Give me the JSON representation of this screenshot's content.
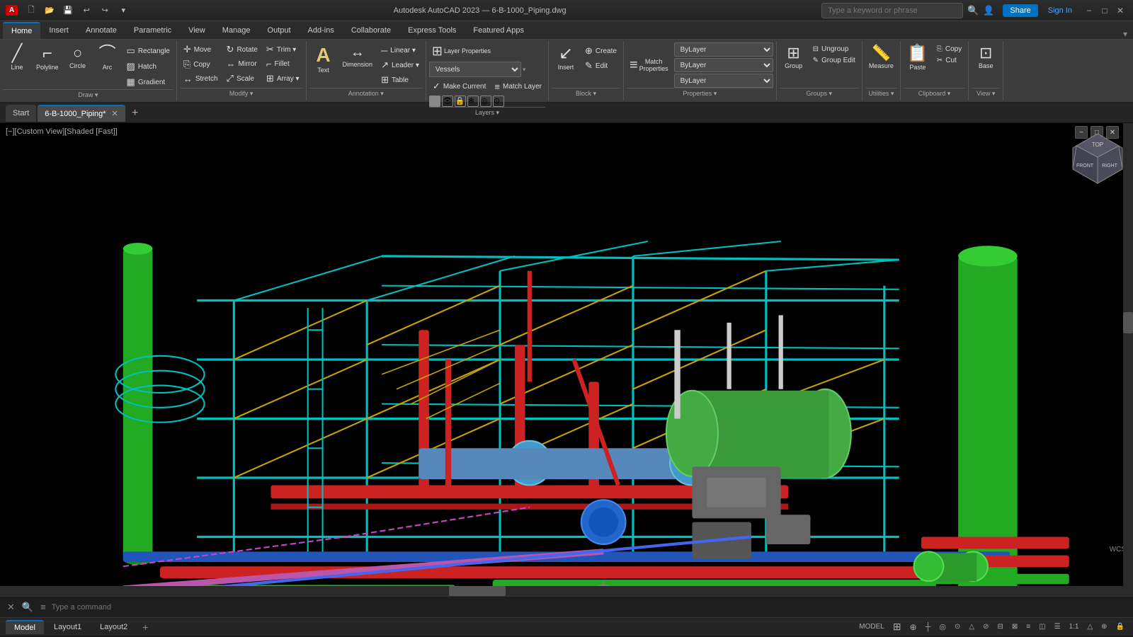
{
  "titlebar": {
    "app_logo": "A",
    "quick_access": [
      "new",
      "open",
      "save",
      "undo",
      "redo"
    ],
    "app_name": "Autodesk AutoCAD 2023",
    "filename": "6-B-1000_Piping.dwg",
    "search_placeholder": "Type a keyword or phrase",
    "share_label": "Share",
    "sign_in_label": "Sign In",
    "win_min": "−",
    "win_max": "□",
    "win_close": "✕"
  },
  "ribbon_tabs": [
    {
      "label": "Home",
      "active": true
    },
    {
      "label": "Insert",
      "active": false
    },
    {
      "label": "Annotate",
      "active": false
    },
    {
      "label": "Parametric",
      "active": false
    },
    {
      "label": "View",
      "active": false
    },
    {
      "label": "Manage",
      "active": false
    },
    {
      "label": "Output",
      "active": false
    },
    {
      "label": "Add-ins",
      "active": false
    },
    {
      "label": "Collaborate",
      "active": false
    },
    {
      "label": "Express Tools",
      "active": false
    },
    {
      "label": "Featured Apps",
      "active": false
    }
  ],
  "ribbon": {
    "sections": {
      "draw": {
        "label": "Draw",
        "buttons": [
          {
            "id": "line",
            "label": "Line",
            "icon": "╱"
          },
          {
            "id": "polyline",
            "label": "Polyline",
            "icon": "⌐"
          },
          {
            "id": "circle",
            "label": "Circle",
            "icon": "○"
          },
          {
            "id": "arc",
            "label": "Arc",
            "icon": "⌒"
          }
        ]
      },
      "modify": {
        "label": "Modify",
        "buttons": [
          {
            "id": "move",
            "label": "Move",
            "icon": "✛"
          },
          {
            "id": "rotate",
            "label": "Rotate",
            "icon": "↻"
          },
          {
            "id": "trim",
            "label": "Trim",
            "icon": "✂"
          },
          {
            "id": "copy",
            "label": "Copy",
            "icon": "⎘"
          },
          {
            "id": "mirror",
            "label": "Mirror",
            "icon": "⇔"
          },
          {
            "id": "fillet",
            "label": "Fillet",
            "icon": "⌐"
          },
          {
            "id": "stretch",
            "label": "Stretch",
            "icon": "↔"
          },
          {
            "id": "scale",
            "label": "Scale",
            "icon": "⤢"
          },
          {
            "id": "array",
            "label": "Array",
            "icon": "⊞"
          }
        ]
      },
      "annotation": {
        "label": "Annotation",
        "buttons": [
          {
            "id": "text",
            "label": "Text",
            "icon": "A"
          },
          {
            "id": "dimension",
            "label": "Dimension",
            "icon": "↔"
          },
          {
            "id": "linear",
            "label": "Linear",
            "icon": "─"
          },
          {
            "id": "leader",
            "label": "Leader",
            "icon": "↗"
          },
          {
            "id": "table",
            "label": "Table",
            "icon": "⊞"
          }
        ]
      },
      "layers": {
        "label": "Layers",
        "layer_name": "Vessels",
        "buttons": [
          {
            "id": "layer-props",
            "label": "Layer Properties",
            "icon": "⊞"
          },
          {
            "id": "make-current",
            "label": "Make Current",
            "icon": "✓"
          },
          {
            "id": "match-layer",
            "label": "Match Layer",
            "icon": "≡"
          }
        ]
      },
      "block": {
        "label": "Block",
        "buttons": [
          {
            "id": "create",
            "label": "Create",
            "icon": "⊕"
          },
          {
            "id": "insert",
            "label": "Insert",
            "icon": "↙"
          },
          {
            "id": "edit",
            "label": "Edit",
            "icon": "✎"
          }
        ]
      },
      "properties": {
        "label": "Properties",
        "dropdowns": [
          {
            "id": "bylayer1",
            "value": "ByLayer"
          },
          {
            "id": "bylayer2",
            "value": "ByLayer"
          },
          {
            "id": "bylayer3",
            "value": "ByLayer"
          }
        ],
        "buttons": [
          {
            "id": "match-props",
            "label": "Match Properties",
            "icon": "≡"
          }
        ]
      },
      "groups": {
        "label": "Groups",
        "buttons": [
          {
            "id": "group",
            "label": "Group",
            "icon": "⊞"
          },
          {
            "id": "ungroup",
            "label": "Ungroup",
            "icon": "⊟"
          }
        ]
      },
      "utilities": {
        "label": "Utilities",
        "buttons": [
          {
            "id": "measure",
            "label": "Measure",
            "icon": "📏"
          }
        ]
      },
      "clipboard": {
        "label": "Clipboard",
        "buttons": [
          {
            "id": "paste",
            "label": "Paste",
            "icon": "📋"
          },
          {
            "id": "copy-clip",
            "label": "Copy",
            "icon": "⎘"
          },
          {
            "id": "cut",
            "label": "Cut",
            "icon": "✂"
          }
        ]
      },
      "view_section": {
        "label": "View",
        "buttons": [
          {
            "id": "base",
            "label": "Base",
            "icon": "⊡"
          }
        ]
      }
    }
  },
  "tabs": [
    {
      "label": "Start",
      "active": false,
      "closeable": false
    },
    {
      "label": "6-B-1000_Piping*",
      "active": true,
      "closeable": true
    }
  ],
  "viewport": {
    "label": "[−][Custom View][Shaded [Fast]]",
    "viewcube": {
      "top": "TOP",
      "front": "FRONT",
      "right": "RIGHT"
    },
    "wcs_label": "WCS"
  },
  "statusbar": {
    "model_label": "MODEL",
    "items": [
      {
        "id": "grid",
        "label": ""
      },
      {
        "id": "snap",
        "label": ""
      },
      {
        "id": "ortho",
        "label": ""
      },
      {
        "id": "polar",
        "label": ""
      },
      {
        "id": "osnap",
        "label": ""
      },
      {
        "id": "otrack",
        "label": ""
      },
      {
        "id": "lwt",
        "label": ""
      },
      {
        "id": "transparency",
        "label": ""
      },
      {
        "id": "qprops",
        "label": ""
      },
      {
        "id": "sc",
        "label": "1:1"
      },
      {
        "id": "annotation",
        "label": ""
      },
      {
        "id": "ws",
        "label": ""
      },
      {
        "id": "lock",
        "label": ""
      }
    ]
  },
  "commandbar": {
    "placeholder": "Type a command"
  },
  "bottom_tabs": [
    {
      "label": "Model",
      "active": true
    },
    {
      "label": "Layout1",
      "active": false
    },
    {
      "label": "Layout2",
      "active": false
    }
  ]
}
